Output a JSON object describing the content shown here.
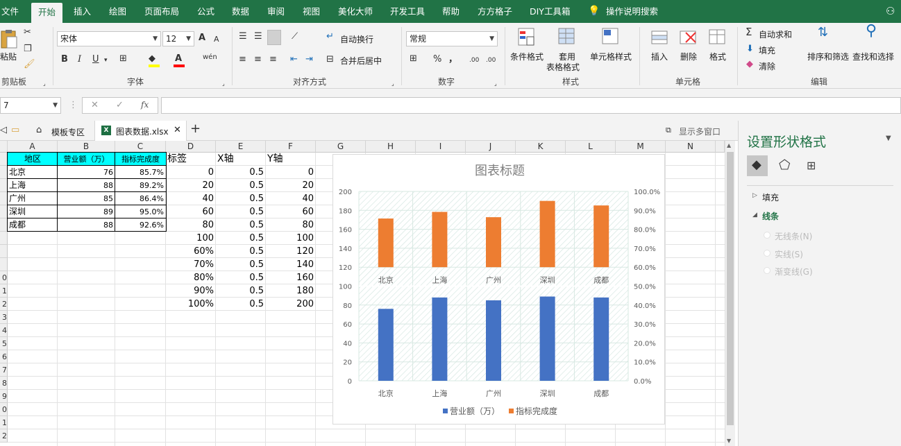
{
  "menu": {
    "items": [
      "文件",
      "开始",
      "插入",
      "绘图",
      "页面布局",
      "公式",
      "数据",
      "审阅",
      "视图",
      "美化大师",
      "开发工具",
      "帮助",
      "方方格子",
      "DIY工具箱"
    ],
    "active": "开始",
    "search": "操作说明搜索"
  },
  "ribbon": {
    "clipboard": {
      "paste": "粘贴",
      "label": "剪贴板"
    },
    "font": {
      "name": "宋体",
      "size": "12",
      "label": "字体",
      "bold": "B",
      "italic": "I",
      "underline": "U",
      "grow": "A",
      "shrink": "A",
      "wen": "wén"
    },
    "align": {
      "wrap": "自动换行",
      "merge": "合并后居中",
      "label": "对齐方式"
    },
    "number": {
      "format": "常规",
      "percent": "%",
      "comma": "，",
      "inc": ".00",
      "dec": ".00",
      "label": "数字"
    },
    "styles": {
      "conditional": "条件格式",
      "table_line1": "套用",
      "table_line2": "表格格式",
      "cell_styles": "单元格样式",
      "label": "样式"
    },
    "cells": {
      "insert": "插入",
      "delete": "删除",
      "format": "格式",
      "label": "单元格"
    },
    "editing": {
      "autosum": "自动求和",
      "fill": "填充",
      "clear": "清除",
      "sort": "排序和筛选",
      "find": "查找和选择",
      "label": "编辑"
    }
  },
  "formula_bar": {
    "name_box": "7",
    "fx": "fx",
    "value": ""
  },
  "tabs": {
    "template": "模板专区",
    "file": "图表数据.xlsx",
    "multi_window": "显示多窗口"
  },
  "sheet": {
    "columns": [
      "A",
      "B",
      "C",
      "D",
      "E",
      "F",
      "G",
      "H",
      "I",
      "J",
      "K",
      "L",
      "M",
      "N"
    ],
    "rows": [
      "",
      "",
      "",
      "",
      "",
      "",
      "",
      "",
      "",
      "0",
      "1",
      "2",
      "3",
      "4",
      "5",
      "6",
      "7",
      "8",
      "9",
      "0",
      "1",
      "2"
    ],
    "headers": {
      "a": "地区",
      "b": "营业额（万）",
      "c": "指标完成度",
      "d": "标签",
      "e": "X轴",
      "f": "Y轴"
    },
    "table": [
      {
        "region": "北京",
        "revenue": "76",
        "rate": "85.7%"
      },
      {
        "region": "上海",
        "revenue": "88",
        "rate": "89.2%"
      },
      {
        "region": "广州",
        "revenue": "85",
        "rate": "86.4%"
      },
      {
        "region": "深圳",
        "revenue": "89",
        "rate": "95.0%"
      },
      {
        "region": "成都",
        "revenue": "88",
        "rate": "92.6%"
      }
    ],
    "aux": [
      {
        "label": "0",
        "x": "0.5",
        "y": "0"
      },
      {
        "label": "20",
        "x": "0.5",
        "y": "20"
      },
      {
        "label": "40",
        "x": "0.5",
        "y": "40"
      },
      {
        "label": "60",
        "x": "0.5",
        "y": "60"
      },
      {
        "label": "80",
        "x": "0.5",
        "y": "80"
      },
      {
        "label": "100",
        "x": "0.5",
        "y": "100"
      },
      {
        "label": "60%",
        "x": "0.5",
        "y": "120"
      },
      {
        "label": "70%",
        "x": "0.5",
        "y": "140"
      },
      {
        "label": "80%",
        "x": "0.5",
        "y": "160"
      },
      {
        "label": "90%",
        "x": "0.5",
        "y": "180"
      },
      {
        "label": "100%",
        "x": "0.5",
        "y": "200"
      }
    ]
  },
  "chart_data": {
    "type": "bar",
    "title": "图表标题",
    "categories": [
      "北京",
      "上海",
      "广州",
      "深圳",
      "成都"
    ],
    "series": [
      {
        "name": "营业额（万）",
        "values": [
          76,
          88,
          85,
          89,
          88
        ],
        "color": "#4472c4",
        "axis": "left"
      },
      {
        "name": "指标完成度",
        "values": [
          85.7,
          89.2,
          86.4,
          95.0,
          92.6
        ],
        "color": "#ed7d31",
        "axis": "right",
        "display": "upper panel: 60% at 120, 100% at 200"
      }
    ],
    "left_ticks": [
      "0",
      "20",
      "40",
      "60",
      "80",
      "100",
      "120",
      "140",
      "160",
      "180",
      "200"
    ],
    "right_ticks": [
      "0.0%",
      "10.0%",
      "20.0%",
      "30.0%",
      "40.0%",
      "50.0%",
      "60.0%",
      "70.0%",
      "80.0%",
      "90.0%",
      "100.0%"
    ],
    "ylim_left": [
      0,
      200
    ],
    "ylim_right": [
      0,
      1
    ],
    "legend": "bottom",
    "grid": true
  },
  "pane": {
    "title": "设置形状格式",
    "fill": "填充",
    "line": "线条",
    "options": [
      "无线条(N)",
      "实线(S)",
      "渐变线(G)"
    ]
  }
}
